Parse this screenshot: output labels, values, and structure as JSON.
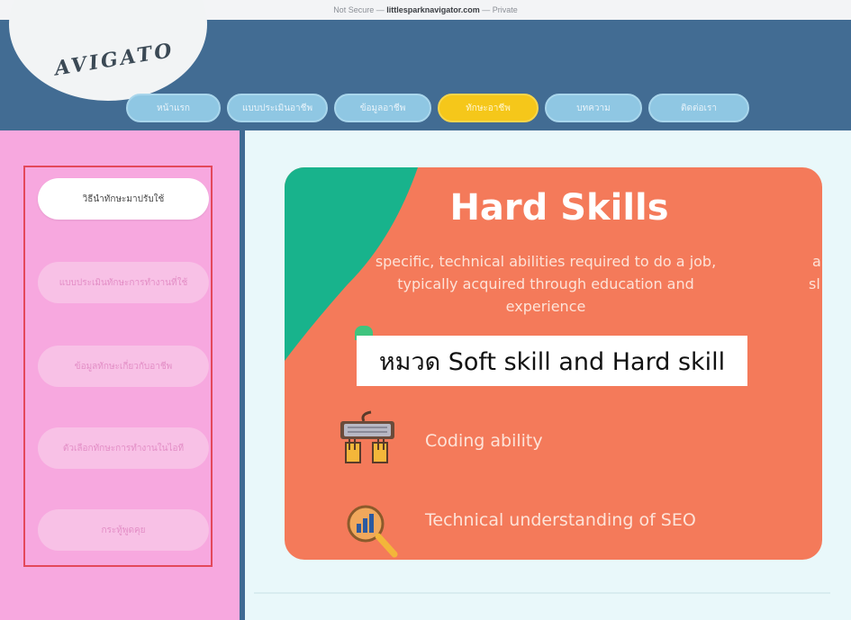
{
  "browser": {
    "status": "Not Secure —",
    "host": "littlesparknavigator.com",
    "mode": "— Private"
  },
  "logo": {
    "text": "AVIGATO"
  },
  "nav": {
    "items": [
      {
        "label": "หน้าแรก",
        "active": false
      },
      {
        "label": "แบบประเมินอาชีพ",
        "active": false
      },
      {
        "label": "ข้อมูลอาชีพ",
        "active": false
      },
      {
        "label": "ทักษะอาชีพ",
        "active": true
      },
      {
        "label": "บทความ",
        "active": false
      },
      {
        "label": "ติดต่อเรา",
        "active": false
      }
    ]
  },
  "sidebar": {
    "items": [
      {
        "label": "วิธีนำทักษะมาปรับใช้"
      },
      {
        "label": "แบบประเมินทักษะการทำงานที่ใช้"
      },
      {
        "label": "ข้อมูลทักษะเกี่ยวกับอาชีพ"
      },
      {
        "label": "ตัวเลือกทักษะการทำงานในไอที"
      },
      {
        "label": "กระทู้พูดคุย"
      }
    ]
  },
  "card": {
    "title": "Hard Skills",
    "description": "specific, technical abilities required to do a job, typically acquired through education and experience",
    "right_cut_1": "a",
    "right_cut_2": "sl",
    "overlay": "หมวด Soft skill and Hard skill",
    "skills": [
      {
        "label": "Coding ability",
        "icon": "keyboard-hands-icon"
      },
      {
        "label": "Technical understanding of SEO",
        "icon": "magnifier-chart-icon"
      }
    ]
  },
  "colors": {
    "header": "#426c93",
    "sidebar": "#f7a8df",
    "card": "#f47a5a",
    "accent_teal": "#18b38c",
    "active_tab": "#f5c71a",
    "highlight_border": "#e4485b"
  }
}
